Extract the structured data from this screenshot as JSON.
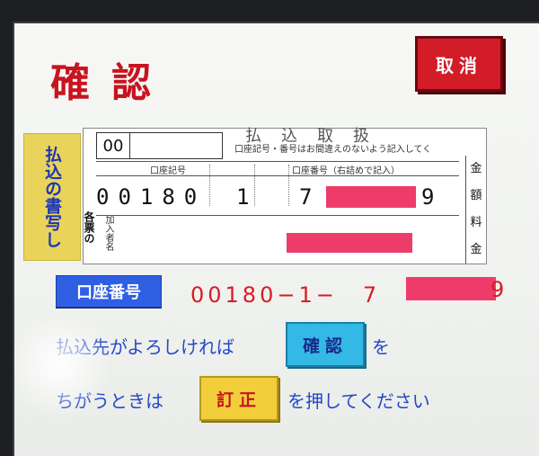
{
  "screen": {
    "title": "確認",
    "cancel_label": "取消",
    "side_label_lines": [
      "払込の",
      "書写し"
    ],
    "form": {
      "code": "00",
      "heading": "払込取扱",
      "note": "口座記号・番号はお間違えのないよう記入してく",
      "account_symbol_label": "口座記号",
      "account_number_label": "口座番号（右詰めで記入）",
      "account_symbol_value": "00180",
      "account_symbol_suffix": "1",
      "account_number_first": "7",
      "account_number_last": "9",
      "right_col_1": "金",
      "right_col_2": "額",
      "right_col_3": "料",
      "right_col_4": "金",
      "subscriber_label": "加入者名",
      "vertical_label": "各票の"
    },
    "account_badge": "口座番号",
    "account_value_prefix": "00180−1−　7",
    "account_value_last": "9",
    "instruction_line1_pre": "払込先がよろしければ",
    "confirm_label": "確認",
    "instruction_line1_post": "を",
    "instruction_line2_pre": "ちがうときは",
    "correct_label": "訂正",
    "instruction_line2_post": "を押してください"
  },
  "colors": {
    "title": "#c8141e",
    "cancel_button": "#d21c28",
    "side_label_bg": "#e9d35a",
    "badge_bg": "#2f5fe3",
    "confirm_bg": "#34b8e6",
    "correct_bg": "#f2ce3a",
    "instruction_text": "#2747c8",
    "redaction": "#ee3c6a"
  }
}
